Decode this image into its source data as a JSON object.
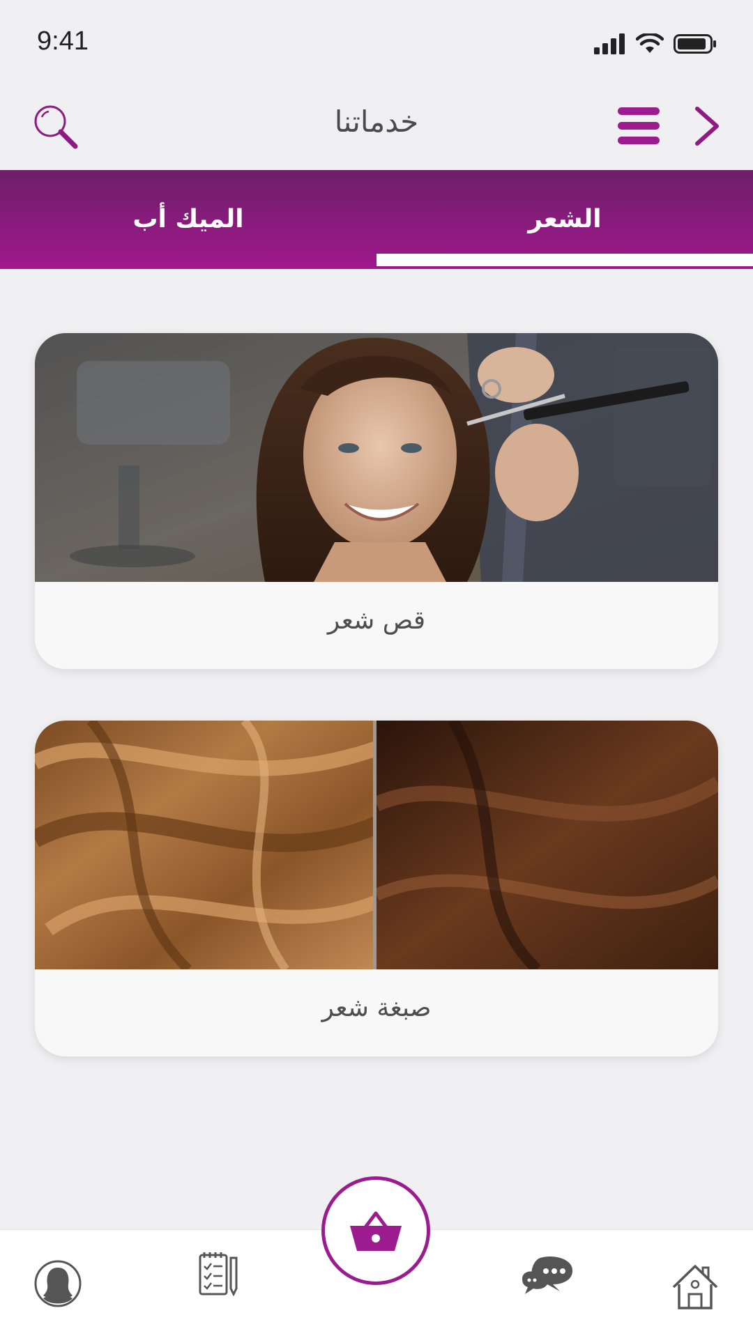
{
  "status_bar": {
    "time": "9:41"
  },
  "header": {
    "title": "خدماتنا"
  },
  "tabs": [
    {
      "label": "الشعر",
      "active": true
    },
    {
      "label": "الميك أب",
      "active": false
    }
  ],
  "services": [
    {
      "label": "قص شعر",
      "image": "woman-hair-cut-photo"
    },
    {
      "label": "صبغة شعر",
      "image": "hair-color-comparison-photo"
    }
  ],
  "bottom_nav": {
    "items": [
      "profile-icon",
      "orders-icon",
      "cart-icon",
      "chat-icon",
      "home-icon"
    ]
  },
  "colors": {
    "accent": "#9c1b8e",
    "accent_dark": "#6d1f6a",
    "background": "#f0f0f2",
    "icon_gray": "#555555"
  }
}
